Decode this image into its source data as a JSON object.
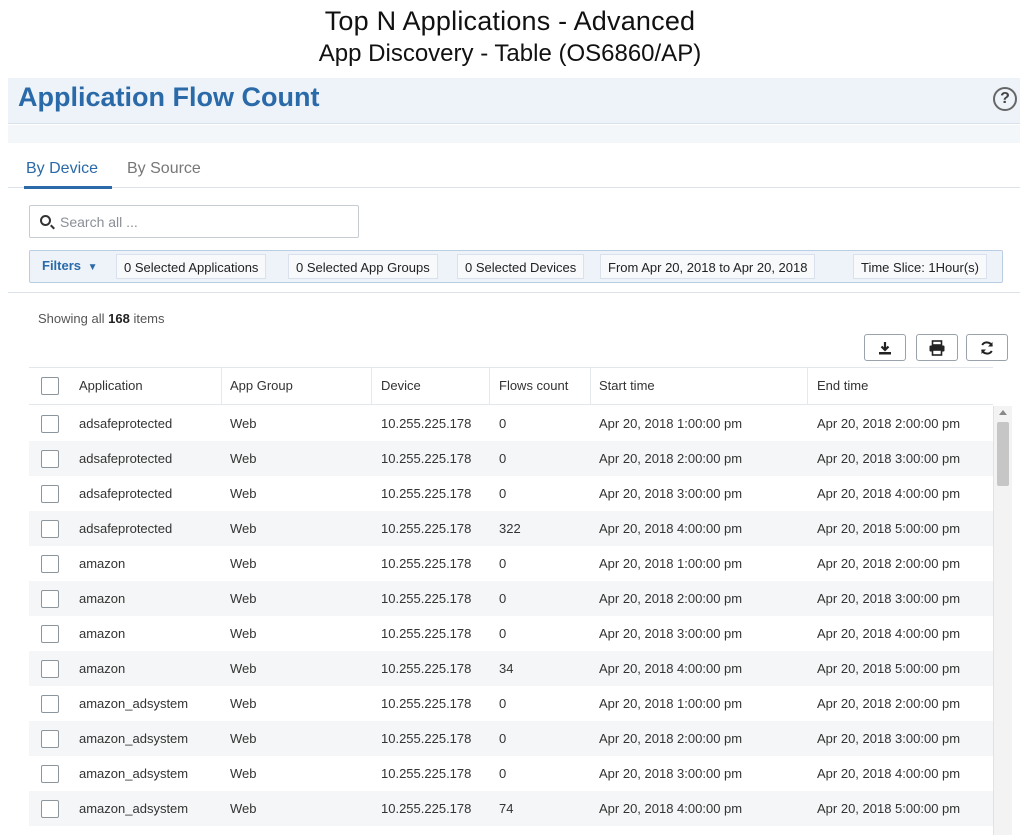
{
  "doc": {
    "title": "Top N Applications - Advanced",
    "subtitle": "App Discovery - Table (OS6860/AP)"
  },
  "panel": {
    "title": "Application Flow Count",
    "help_icon": "?",
    "tabs": [
      {
        "label": "By Device",
        "active": true
      },
      {
        "label": "By Source",
        "active": false
      }
    ],
    "search": {
      "placeholder": "Search all ...",
      "value": ""
    },
    "filters": {
      "label": "Filters",
      "chips": [
        "0 Selected Applications",
        "0 Selected App Groups",
        "0 Selected Devices",
        "From Apr 20, 2018 to Apr 20, 2018",
        "Time Slice: 1Hour(s)"
      ]
    },
    "showing": {
      "prefix": "Showing all",
      "count": "168",
      "suffix": "items"
    },
    "toolbar": {
      "icons": [
        "download-icon",
        "print-icon",
        "refresh-icon"
      ]
    }
  },
  "table": {
    "columns": [
      "Application",
      "App Group",
      "Device",
      "Flows count",
      "Start time",
      "End time"
    ],
    "rows": [
      [
        "adsafeprotected",
        "Web",
        "10.255.225.178",
        "0",
        "Apr 20, 2018 1:00:00 pm",
        "Apr 20, 2018 2:00:00 pm"
      ],
      [
        "adsafeprotected",
        "Web",
        "10.255.225.178",
        "0",
        "Apr 20, 2018 2:00:00 pm",
        "Apr 20, 2018 3:00:00 pm"
      ],
      [
        "adsafeprotected",
        "Web",
        "10.255.225.178",
        "0",
        "Apr 20, 2018 3:00:00 pm",
        "Apr 20, 2018 4:00:00 pm"
      ],
      [
        "adsafeprotected",
        "Web",
        "10.255.225.178",
        "322",
        "Apr 20, 2018 4:00:00 pm",
        "Apr 20, 2018 5:00:00 pm"
      ],
      [
        "amazon",
        "Web",
        "10.255.225.178",
        "0",
        "Apr 20, 2018 1:00:00 pm",
        "Apr 20, 2018 2:00:00 pm"
      ],
      [
        "amazon",
        "Web",
        "10.255.225.178",
        "0",
        "Apr 20, 2018 2:00:00 pm",
        "Apr 20, 2018 3:00:00 pm"
      ],
      [
        "amazon",
        "Web",
        "10.255.225.178",
        "0",
        "Apr 20, 2018 3:00:00 pm",
        "Apr 20, 2018 4:00:00 pm"
      ],
      [
        "amazon",
        "Web",
        "10.255.225.178",
        "34",
        "Apr 20, 2018 4:00:00 pm",
        "Apr 20, 2018 5:00:00 pm"
      ],
      [
        "amazon_adsystem",
        "Web",
        "10.255.225.178",
        "0",
        "Apr 20, 2018 1:00:00 pm",
        "Apr 20, 2018 2:00:00 pm"
      ],
      [
        "amazon_adsystem",
        "Web",
        "10.255.225.178",
        "0",
        "Apr 20, 2018 2:00:00 pm",
        "Apr 20, 2018 3:00:00 pm"
      ],
      [
        "amazon_adsystem",
        "Web",
        "10.255.225.178",
        "0",
        "Apr 20, 2018 3:00:00 pm",
        "Apr 20, 2018 4:00:00 pm"
      ],
      [
        "amazon_adsystem",
        "Web",
        "10.255.225.178",
        "74",
        "Apr 20, 2018 4:00:00 pm",
        "Apr 20, 2018 5:00:00 pm"
      ]
    ]
  },
  "colors": {
    "accent": "#2a6aa8",
    "header_bg": "#eef3f9",
    "row_alt": "#f5f6f7"
  }
}
